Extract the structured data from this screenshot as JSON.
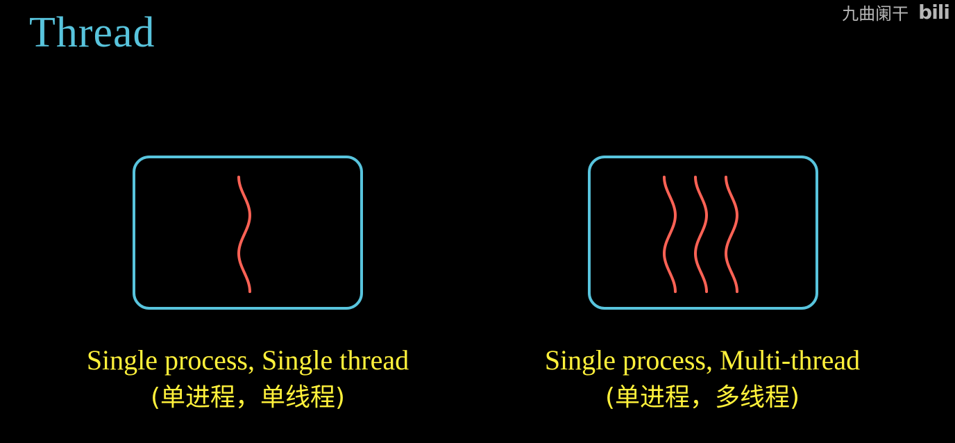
{
  "title": "Thread",
  "watermark": {
    "text": "九曲阑干",
    "logo": "bili"
  },
  "colors": {
    "process_box": "#58c4dd",
    "thread": "#fc6255",
    "caption": "#fff13b",
    "title": "#58c4dd"
  },
  "panels": [
    {
      "caption_en": "Single process, Single thread",
      "caption_cn": "(单进程，单线程)",
      "threads": 1
    },
    {
      "caption_en": "Single process, Multi-thread",
      "caption_cn": "(单进程，多线程)",
      "threads": 3
    }
  ]
}
